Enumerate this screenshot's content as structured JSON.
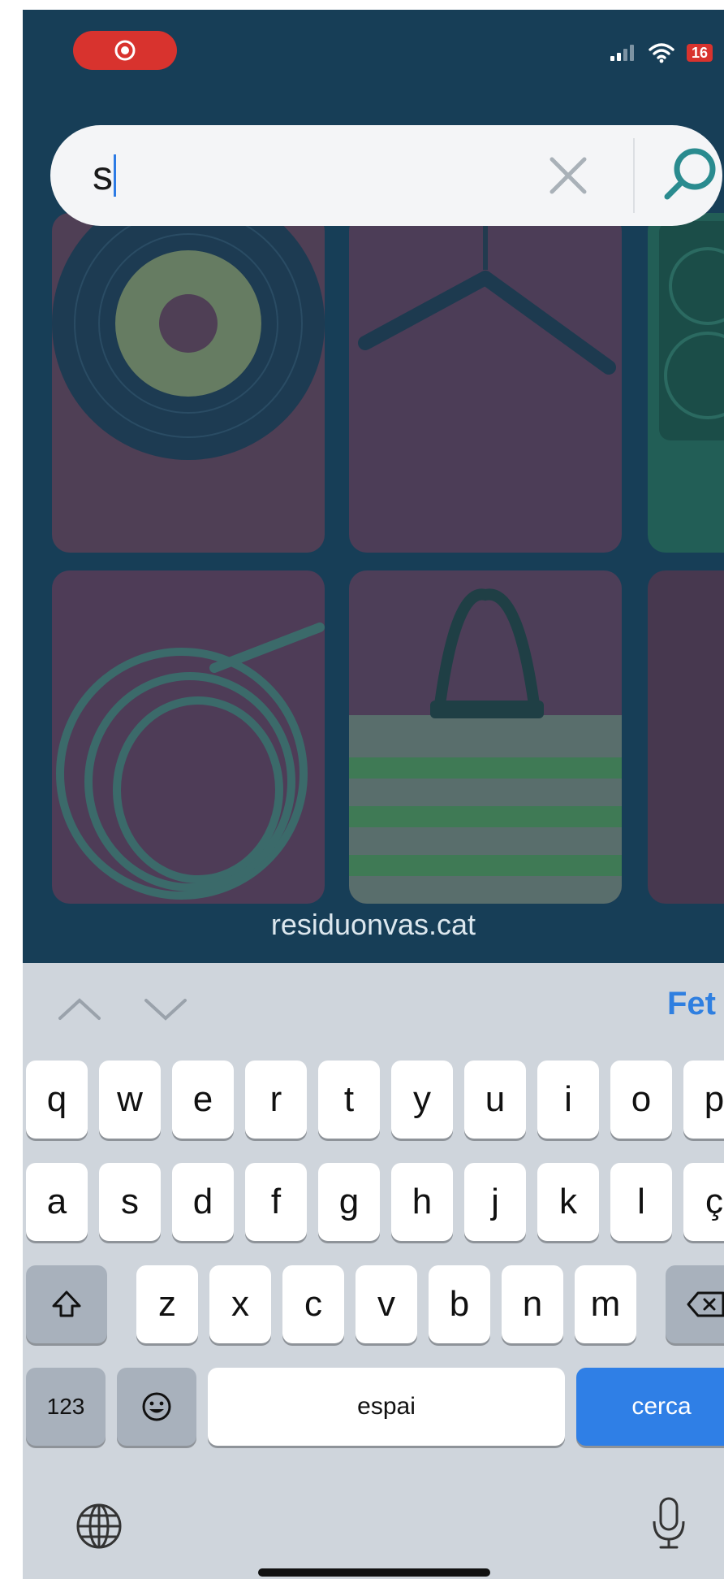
{
  "status_bar": {
    "recording_icon": "record-icon",
    "signal_icon": "cellular-signal-icon",
    "wifi_icon": "wifi-icon",
    "battery_level": "16",
    "colors": {
      "recording": "#d8332e",
      "battery": "#d8332e"
    }
  },
  "search": {
    "value": "s",
    "clear_icon": "close-icon",
    "submit_icon": "search-icon"
  },
  "grid": {
    "items": [
      {
        "icon": "vinyl-record"
      },
      {
        "icon": "clothes-hanger"
      },
      {
        "icon": "speaker"
      },
      {
        "icon": "rope-cable"
      },
      {
        "icon": "woven-basket"
      },
      {
        "icon": "unknown-item"
      }
    ],
    "site_label": "residuonvas.cat"
  },
  "keyboard": {
    "toolbar": {
      "prev_icon": "chevron-up-icon",
      "next_icon": "chevron-down-icon",
      "done_label": "Fet"
    },
    "row1": [
      "q",
      "w",
      "e",
      "r",
      "t",
      "y",
      "u",
      "i",
      "o",
      "p"
    ],
    "row2": [
      "a",
      "s",
      "d",
      "f",
      "g",
      "h",
      "j",
      "k",
      "l",
      "ç"
    ],
    "row3": [
      "z",
      "x",
      "c",
      "v",
      "b",
      "n",
      "m"
    ],
    "shift_icon": "shift-icon",
    "backspace_icon": "backspace-icon",
    "numbers_label": "123",
    "emoji_icon": "emoji-icon",
    "space_label": "espai",
    "search_label": "cerca",
    "globe_icon": "globe-icon",
    "mic_icon": "microphone-icon",
    "colors": {
      "accent": "#2f7fe6",
      "background": "#cfd5dc"
    }
  }
}
